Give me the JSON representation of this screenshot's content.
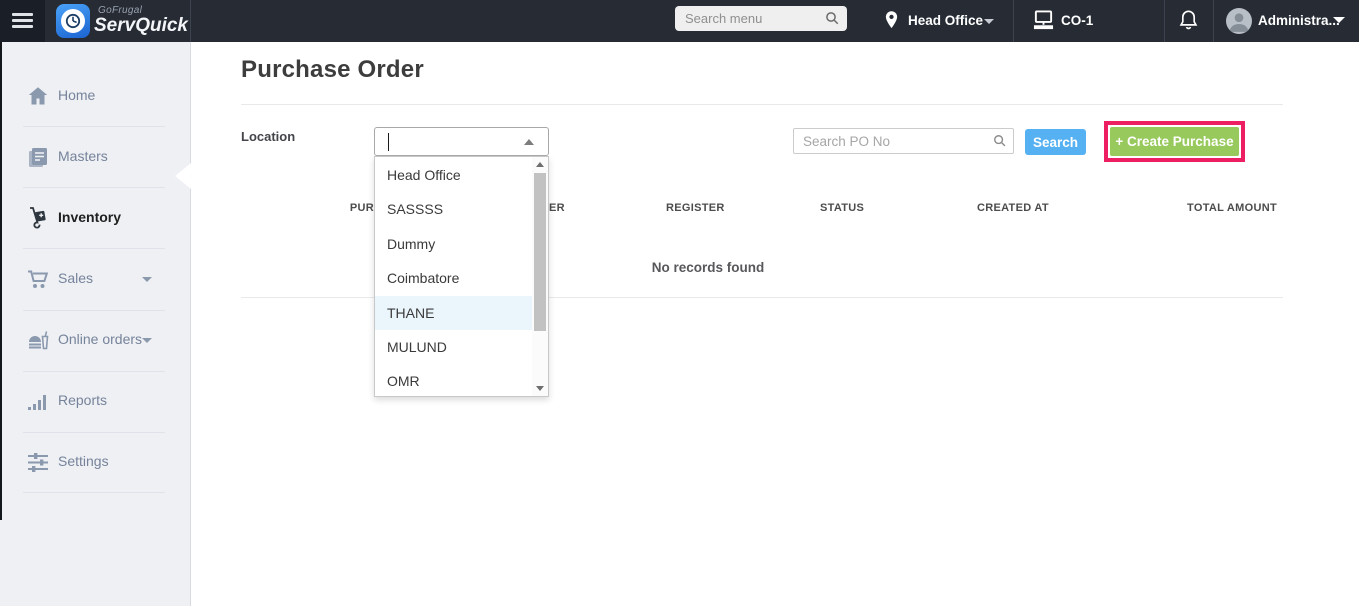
{
  "topbar": {
    "brand": {
      "company": "GoFrugal",
      "product": "ServQuick"
    },
    "menu_search": {
      "placeholder": "Search menu"
    },
    "location": {
      "label": "Head Office"
    },
    "register": {
      "label": "CO-1"
    },
    "user": {
      "name": "Administra..."
    }
  },
  "sidebar": {
    "items": [
      {
        "label": "Home",
        "icon": "home-icon",
        "active": false,
        "expandable": false
      },
      {
        "label": "Masters",
        "icon": "masters-icon",
        "active": false,
        "expandable": false
      },
      {
        "label": "Inventory",
        "icon": "inventory-icon",
        "active": true,
        "expandable": false
      },
      {
        "label": "Sales",
        "icon": "sales-icon",
        "active": false,
        "expandable": true
      },
      {
        "label": "Online orders",
        "icon": "online-orders-icon",
        "active": false,
        "expandable": true
      },
      {
        "label": "Reports",
        "icon": "reports-icon",
        "active": false,
        "expandable": false
      },
      {
        "label": "Settings",
        "icon": "settings-icon",
        "active": false,
        "expandable": false
      }
    ]
  },
  "page": {
    "title": "Purchase Order",
    "filters": {
      "location_label": "Location",
      "po_search": {
        "placeholder": "Search PO No"
      },
      "search_button": "Search",
      "create_button": "+ Create Purchase"
    },
    "table": {
      "headers": [
        "PUR",
        "ER",
        "REGISTER",
        "STATUS",
        "CREATED AT",
        "TOTAL AMOUNT"
      ],
      "empty_message": "No records found"
    }
  },
  "location_dropdown": {
    "value": "",
    "options": [
      "Head Office",
      "SASSSS",
      "Dummy",
      "Coimbatore",
      "THANE",
      "MULUND",
      "OMR"
    ],
    "highlighted_option": "THANE"
  },
  "colors": {
    "topbar_bg": "#262b34",
    "sidebar_bg": "#eef0f4",
    "accent_blue": "#55b1f1",
    "accent_green": "#97c95c",
    "highlight_pink": "#ee1e63",
    "option_hover_bg": "#eaf5fc"
  }
}
